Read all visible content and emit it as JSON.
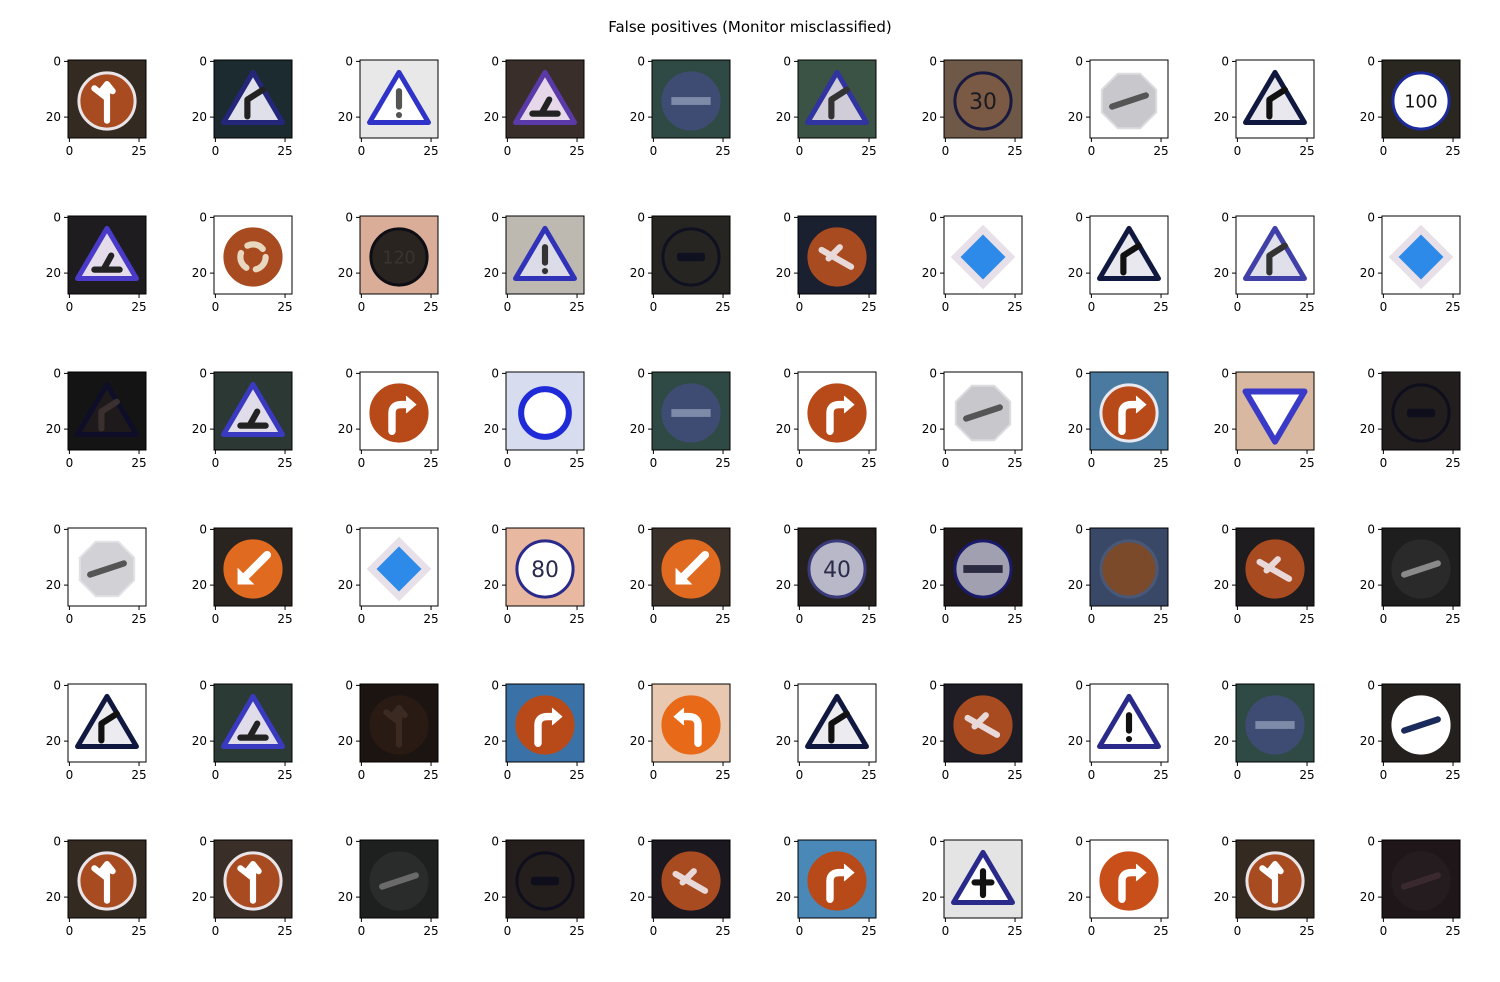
{
  "chart_data": {
    "type": "image_grid",
    "title": "False positives (Monitor misclassified)",
    "rows": 6,
    "cols": 10,
    "image_size": 28,
    "x_ticks": [
      0,
      25
    ],
    "y_ticks": [
      0,
      20
    ],
    "palette": {
      "white": "#ffffff",
      "dark": "#1e1c1c",
      "red_brown": "#a84b20",
      "orange": "#e06a1f",
      "blue_navy": "#1c1f6a",
      "blue_bright": "#2b2ee0",
      "teal_dark": "#2f4a44",
      "skin": "#d9ad98",
      "gray_light": "#d6d6d8",
      "brown_dark": "#2c1e1a"
    },
    "tiles": [
      {
        "bg": "#332a22",
        "sign": "circle",
        "fill": "#a84b20",
        "stroke": "#e8e4e8",
        "glyph": "split-arrow",
        "glyph_color": "#ffffff"
      },
      {
        "bg": "#1c2b30",
        "sign": "triangle",
        "fill": "#dfe0ea",
        "stroke": "#24267a",
        "glyph": "curve-right",
        "glyph_color": "#222222"
      },
      {
        "bg": "#e8e8e8",
        "sign": "triangle",
        "fill": "#ffffff",
        "stroke": "#3033c8",
        "glyph": "excl",
        "glyph_color": "#555555"
      },
      {
        "bg": "#3a2e2a",
        "sign": "triangle",
        "fill": "#e6d8e8",
        "stroke": "#5a3aa8",
        "glyph": "roadworks",
        "glyph_color": "#222222"
      },
      {
        "bg": "#2f4a44",
        "sign": "circle",
        "fill": "#3e4c73",
        "stroke": "#3e4c73",
        "glyph": "bar",
        "glyph_color": "#7d8aa8"
      },
      {
        "bg": "#3b5344",
        "sign": "triangle",
        "fill": "#d0ccd8",
        "stroke": "#3033a0",
        "glyph": "curve-right",
        "glyph_color": "#333333"
      },
      {
        "bg": "#6e5848",
        "sign": "circle",
        "fill": "#7a5a44",
        "stroke": "#1a1a40",
        "glyph": "text:30",
        "glyph_color": "#1a1a20"
      },
      {
        "bg": "#ffffff",
        "sign": "octagon",
        "fill": "#c8c8cc",
        "stroke": "#dcdce0",
        "glyph": "slash",
        "glyph_color": "#555555"
      },
      {
        "bg": "#ffffff",
        "sign": "triangle",
        "fill": "#e8e8ee",
        "stroke": "#101840",
        "glyph": "curve-right",
        "glyph_color": "#111111"
      },
      {
        "bg": "#2a2620",
        "sign": "circle",
        "fill": "#ffffff",
        "stroke": "#1c2a9a",
        "glyph": "text:100",
        "glyph_color": "#111111"
      },
      {
        "bg": "#1f1c20",
        "sign": "triangle",
        "fill": "#e4dcea",
        "stroke": "#4a3ac8",
        "glyph": "roadworks",
        "glyph_color": "#222222"
      },
      {
        "bg": "#ffffff",
        "sign": "circle",
        "fill": "#a84b20",
        "stroke": "#a84b20",
        "glyph": "roundabout",
        "glyph_color": "#e8d8c0"
      },
      {
        "bg": "#d9ad98",
        "sign": "circle",
        "fill": "#2a2420",
        "stroke": "#0e0e14",
        "glyph": "text:120",
        "glyph_color": "#3a3430"
      },
      {
        "bg": "#bdb8b0",
        "sign": "triangle",
        "fill": "#dcdce8",
        "stroke": "#3033b8",
        "glyph": "excl",
        "glyph_color": "#333333"
      },
      {
        "bg": "#272522",
        "sign": "circle",
        "fill": "#272522",
        "stroke": "#0f1020",
        "glyph": "car",
        "glyph_color": "#0f1020"
      },
      {
        "bg": "#1b2030",
        "sign": "circle",
        "fill": "#a84b20",
        "stroke": "#a84b20",
        "glyph": "slash-multi",
        "glyph_color": "#e8d8d8"
      },
      {
        "bg": "#ffffff",
        "sign": "diamond",
        "fill": "#2d8ae8",
        "stroke": "#e8e0e8",
        "glyph": "none",
        "glyph_color": "#ffffff"
      },
      {
        "bg": "#ffffff",
        "sign": "triangle",
        "fill": "#e8e8ee",
        "stroke": "#101840",
        "glyph": "curve-right",
        "glyph_color": "#111111"
      },
      {
        "bg": "#ffffff",
        "sign": "triangle",
        "fill": "#e0e0ea",
        "stroke": "#4040a8",
        "glyph": "curve-right",
        "glyph_color": "#333333"
      },
      {
        "bg": "#ffffff",
        "sign": "diamond",
        "fill": "#2d8ae8",
        "stroke": "#e8e0e8",
        "glyph": "none",
        "glyph_color": "#ffffff"
      },
      {
        "bg": "#141414",
        "sign": "triangle",
        "fill": "#1e1a1c",
        "stroke": "#0e0e28",
        "glyph": "curve-right",
        "glyph_color": "#3a3030"
      },
      {
        "bg": "#2c3834",
        "sign": "triangle",
        "fill": "#e0dcea",
        "stroke": "#3a3ac0",
        "glyph": "roadworks",
        "glyph_color": "#222222"
      },
      {
        "bg": "#ffffff",
        "sign": "circle",
        "fill": "#b84a1a",
        "stroke": "#b84a1a",
        "glyph": "turn-right",
        "glyph_color": "#ffffff"
      },
      {
        "bg": "#d8dcef",
        "sign": "ring",
        "fill": "#ffffff",
        "stroke": "#1f2ad8",
        "glyph": "none",
        "glyph_color": "#ffffff"
      },
      {
        "bg": "#2f4a44",
        "sign": "circle",
        "fill": "#3e4c73",
        "stroke": "#3e4c73",
        "glyph": "bar",
        "glyph_color": "#7d8aa8"
      },
      {
        "bg": "#ffffff",
        "sign": "circle",
        "fill": "#b84a1a",
        "stroke": "#b84a1a",
        "glyph": "turn-right",
        "glyph_color": "#ffffff"
      },
      {
        "bg": "#ffffff",
        "sign": "octagon",
        "fill": "#c8c8cc",
        "stroke": "#dcdce0",
        "glyph": "slash",
        "glyph_color": "#555555"
      },
      {
        "bg": "#4a7aa0",
        "sign": "circle",
        "fill": "#b84a1a",
        "stroke": "#e8e8f0",
        "glyph": "turn-right",
        "glyph_color": "#ffffff"
      },
      {
        "bg": "#d8b8a0",
        "sign": "inv-triangle",
        "fill": "#ffffff",
        "stroke": "#3a3ac8",
        "glyph": "none",
        "glyph_color": "#ffffff"
      },
      {
        "bg": "#221e1e",
        "sign": "circle",
        "fill": "#221e1e",
        "stroke": "#0e0e1c",
        "glyph": "car",
        "glyph_color": "#0e0e1c"
      },
      {
        "bg": "#ffffff",
        "sign": "octagon",
        "fill": "#d2d2d6",
        "stroke": "#e2e2e6",
        "glyph": "slash",
        "glyph_color": "#555555"
      },
      {
        "bg": "#2a2420",
        "sign": "circle",
        "fill": "#e06a1f",
        "stroke": "#e06a1f",
        "glyph": "arrow-down-left",
        "glyph_color": "#ffffff"
      },
      {
        "bg": "#ffffff",
        "sign": "diamond",
        "fill": "#2d8ae8",
        "stroke": "#e8e0e8",
        "glyph": "none",
        "glyph_color": "#ffffff"
      },
      {
        "bg": "#e8b8a0",
        "sign": "circle",
        "fill": "#ffffff",
        "stroke": "#2a2a8a",
        "glyph": "text:80",
        "glyph_color": "#2a2a4a"
      },
      {
        "bg": "#3a302a",
        "sign": "circle",
        "fill": "#e06a1f",
        "stroke": "#e06a1f",
        "glyph": "arrow-down-left",
        "glyph_color": "#ffffff"
      },
      {
        "bg": "#24201e",
        "sign": "circle",
        "fill": "#b8b8c8",
        "stroke": "#3a3a7a",
        "glyph": "text:40",
        "glyph_color": "#2a2a4a"
      },
      {
        "bg": "#201a1a",
        "sign": "circle",
        "fill": "#a0a0b0",
        "stroke": "#1a1a6a",
        "glyph": "bar",
        "glyph_color": "#2a2a40"
      },
      {
        "bg": "#3a4868",
        "sign": "circle",
        "fill": "#7a4a2a",
        "stroke": "#4a5878",
        "glyph": "none",
        "glyph_color": "#ffffff"
      },
      {
        "bg": "#1e1c1e",
        "sign": "circle",
        "fill": "#a84b20",
        "stroke": "#a84b20",
        "glyph": "slash-multi",
        "glyph_color": "#e8d8d8"
      },
      {
        "bg": "#1e1e1e",
        "sign": "circle",
        "fill": "#2a2a2a",
        "stroke": "#2a2a2a",
        "glyph": "slash",
        "glyph_color": "#8a8a8a"
      },
      {
        "bg": "#ffffff",
        "sign": "triangle",
        "fill": "#ececf0",
        "stroke": "#101840",
        "glyph": "curve-right",
        "glyph_color": "#111111"
      },
      {
        "bg": "#2c3a36",
        "sign": "triangle",
        "fill": "#e0dcea",
        "stroke": "#3a3ac0",
        "glyph": "roadworks",
        "glyph_color": "#222222"
      },
      {
        "bg": "#1c1410",
        "sign": "circle",
        "fill": "#2a1a14",
        "stroke": "#2a1a14",
        "glyph": "split-arrow",
        "glyph_color": "#3a2a22"
      },
      {
        "bg": "#3a72a8",
        "sign": "circle",
        "fill": "#b84a1a",
        "stroke": "#b84a1a",
        "glyph": "turn-right",
        "glyph_color": "#ffffff"
      },
      {
        "bg": "#e8c8b0",
        "sign": "circle",
        "fill": "#e86a18",
        "stroke": "#e86a18",
        "glyph": "turn-left",
        "glyph_color": "#ffffff"
      },
      {
        "bg": "#ffffff",
        "sign": "triangle",
        "fill": "#ececf0",
        "stroke": "#101840",
        "glyph": "curve-right",
        "glyph_color": "#111111"
      },
      {
        "bg": "#1e1c24",
        "sign": "circle",
        "fill": "#a84b20",
        "stroke": "#a84b20",
        "glyph": "slash-multi",
        "glyph_color": "#e8d8d8"
      },
      {
        "bg": "#ffffff",
        "sign": "triangle",
        "fill": "#ffffff",
        "stroke": "#2a2a8a",
        "glyph": "excl",
        "glyph_color": "#111111"
      },
      {
        "bg": "#2f4a44",
        "sign": "circle",
        "fill": "#3e4c73",
        "stroke": "#3e4c73",
        "glyph": "bar",
        "glyph_color": "#7d8aa8"
      },
      {
        "bg": "#24201e",
        "sign": "circle",
        "fill": "#ffffff",
        "stroke": "#ffffff",
        "glyph": "slash",
        "glyph_color": "#1a2a5a"
      },
      {
        "bg": "#332a22",
        "sign": "circle",
        "fill": "#a84b20",
        "stroke": "#e8e4e8",
        "glyph": "split-arrow",
        "glyph_color": "#ffffff"
      },
      {
        "bg": "#3a2e28",
        "sign": "circle",
        "fill": "#a84b20",
        "stroke": "#e8e4e8",
        "glyph": "split-arrow",
        "glyph_color": "#ffffff"
      },
      {
        "bg": "#1e2020",
        "sign": "circle",
        "fill": "#2a2c2c",
        "stroke": "#2a2c2c",
        "glyph": "slash",
        "glyph_color": "#6a6a6a"
      },
      {
        "bg": "#241e1c",
        "sign": "circle",
        "fill": "#241e1c",
        "stroke": "#0e0e1c",
        "glyph": "car",
        "glyph_color": "#0e0e1c"
      },
      {
        "bg": "#1c1820",
        "sign": "circle",
        "fill": "#a84b20",
        "stroke": "#a84b20",
        "glyph": "slash-multi",
        "glyph_color": "#e8d8d8"
      },
      {
        "bg": "#4a88b8",
        "sign": "circle",
        "fill": "#b84a1a",
        "stroke": "#b84a1a",
        "glyph": "turn-right",
        "glyph_color": "#ffffff"
      },
      {
        "bg": "#e4e4e4",
        "sign": "triangle",
        "fill": "#ffffff",
        "stroke": "#2a2a8a",
        "glyph": "cross",
        "glyph_color": "#111111"
      },
      {
        "bg": "#ffffff",
        "sign": "circle",
        "fill": "#c84e1a",
        "stroke": "#c84e1a",
        "glyph": "turn-right",
        "glyph_color": "#ffffff"
      },
      {
        "bg": "#332a22",
        "sign": "circle",
        "fill": "#a84b20",
        "stroke": "#e8e4e8",
        "glyph": "split-arrow",
        "glyph_color": "#ffffff"
      },
      {
        "bg": "#1e1618",
        "sign": "circle",
        "fill": "#241c1e",
        "stroke": "#241c1e",
        "glyph": "slash",
        "glyph_color": "#3a2a30"
      }
    ]
  }
}
